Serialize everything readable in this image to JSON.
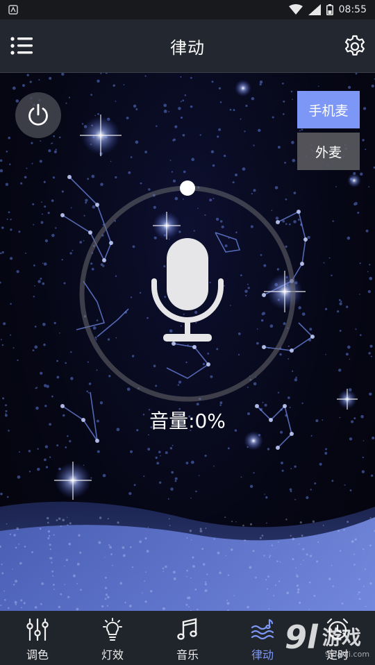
{
  "status_bar": {
    "time": "08:55",
    "icons": [
      "android-notification-icon",
      "wifi-icon",
      "signal-icon",
      "battery-icon"
    ]
  },
  "header": {
    "title": "律动",
    "menu_icon": "menu-icon",
    "settings_icon": "gear-icon"
  },
  "power": {
    "icon": "power-icon"
  },
  "mic_sources": {
    "phone_mic": "手机麦",
    "external_mic": "外麦",
    "selected": "phone_mic"
  },
  "volume": {
    "label": "音量:0%",
    "level": 0
  },
  "tabs": [
    {
      "label": "调色",
      "icon": "sliders-icon",
      "active": false
    },
    {
      "label": "灯效",
      "icon": "bulb-icon",
      "active": false
    },
    {
      "label": "音乐",
      "icon": "music-note-icon",
      "active": false
    },
    {
      "label": "律动",
      "icon": "wave-note-icon",
      "active": true
    },
    {
      "label": "定时",
      "icon": "alarm-clock-icon",
      "active": false
    }
  ],
  "colors": {
    "accent": "#7d97f6",
    "header_bg": "#23272f",
    "tabbar_bg": "#20242b",
    "secondary_button": "#5f5f64"
  },
  "watermark": {
    "text": "9l游戏",
    "sub": "9Idanji.com"
  }
}
